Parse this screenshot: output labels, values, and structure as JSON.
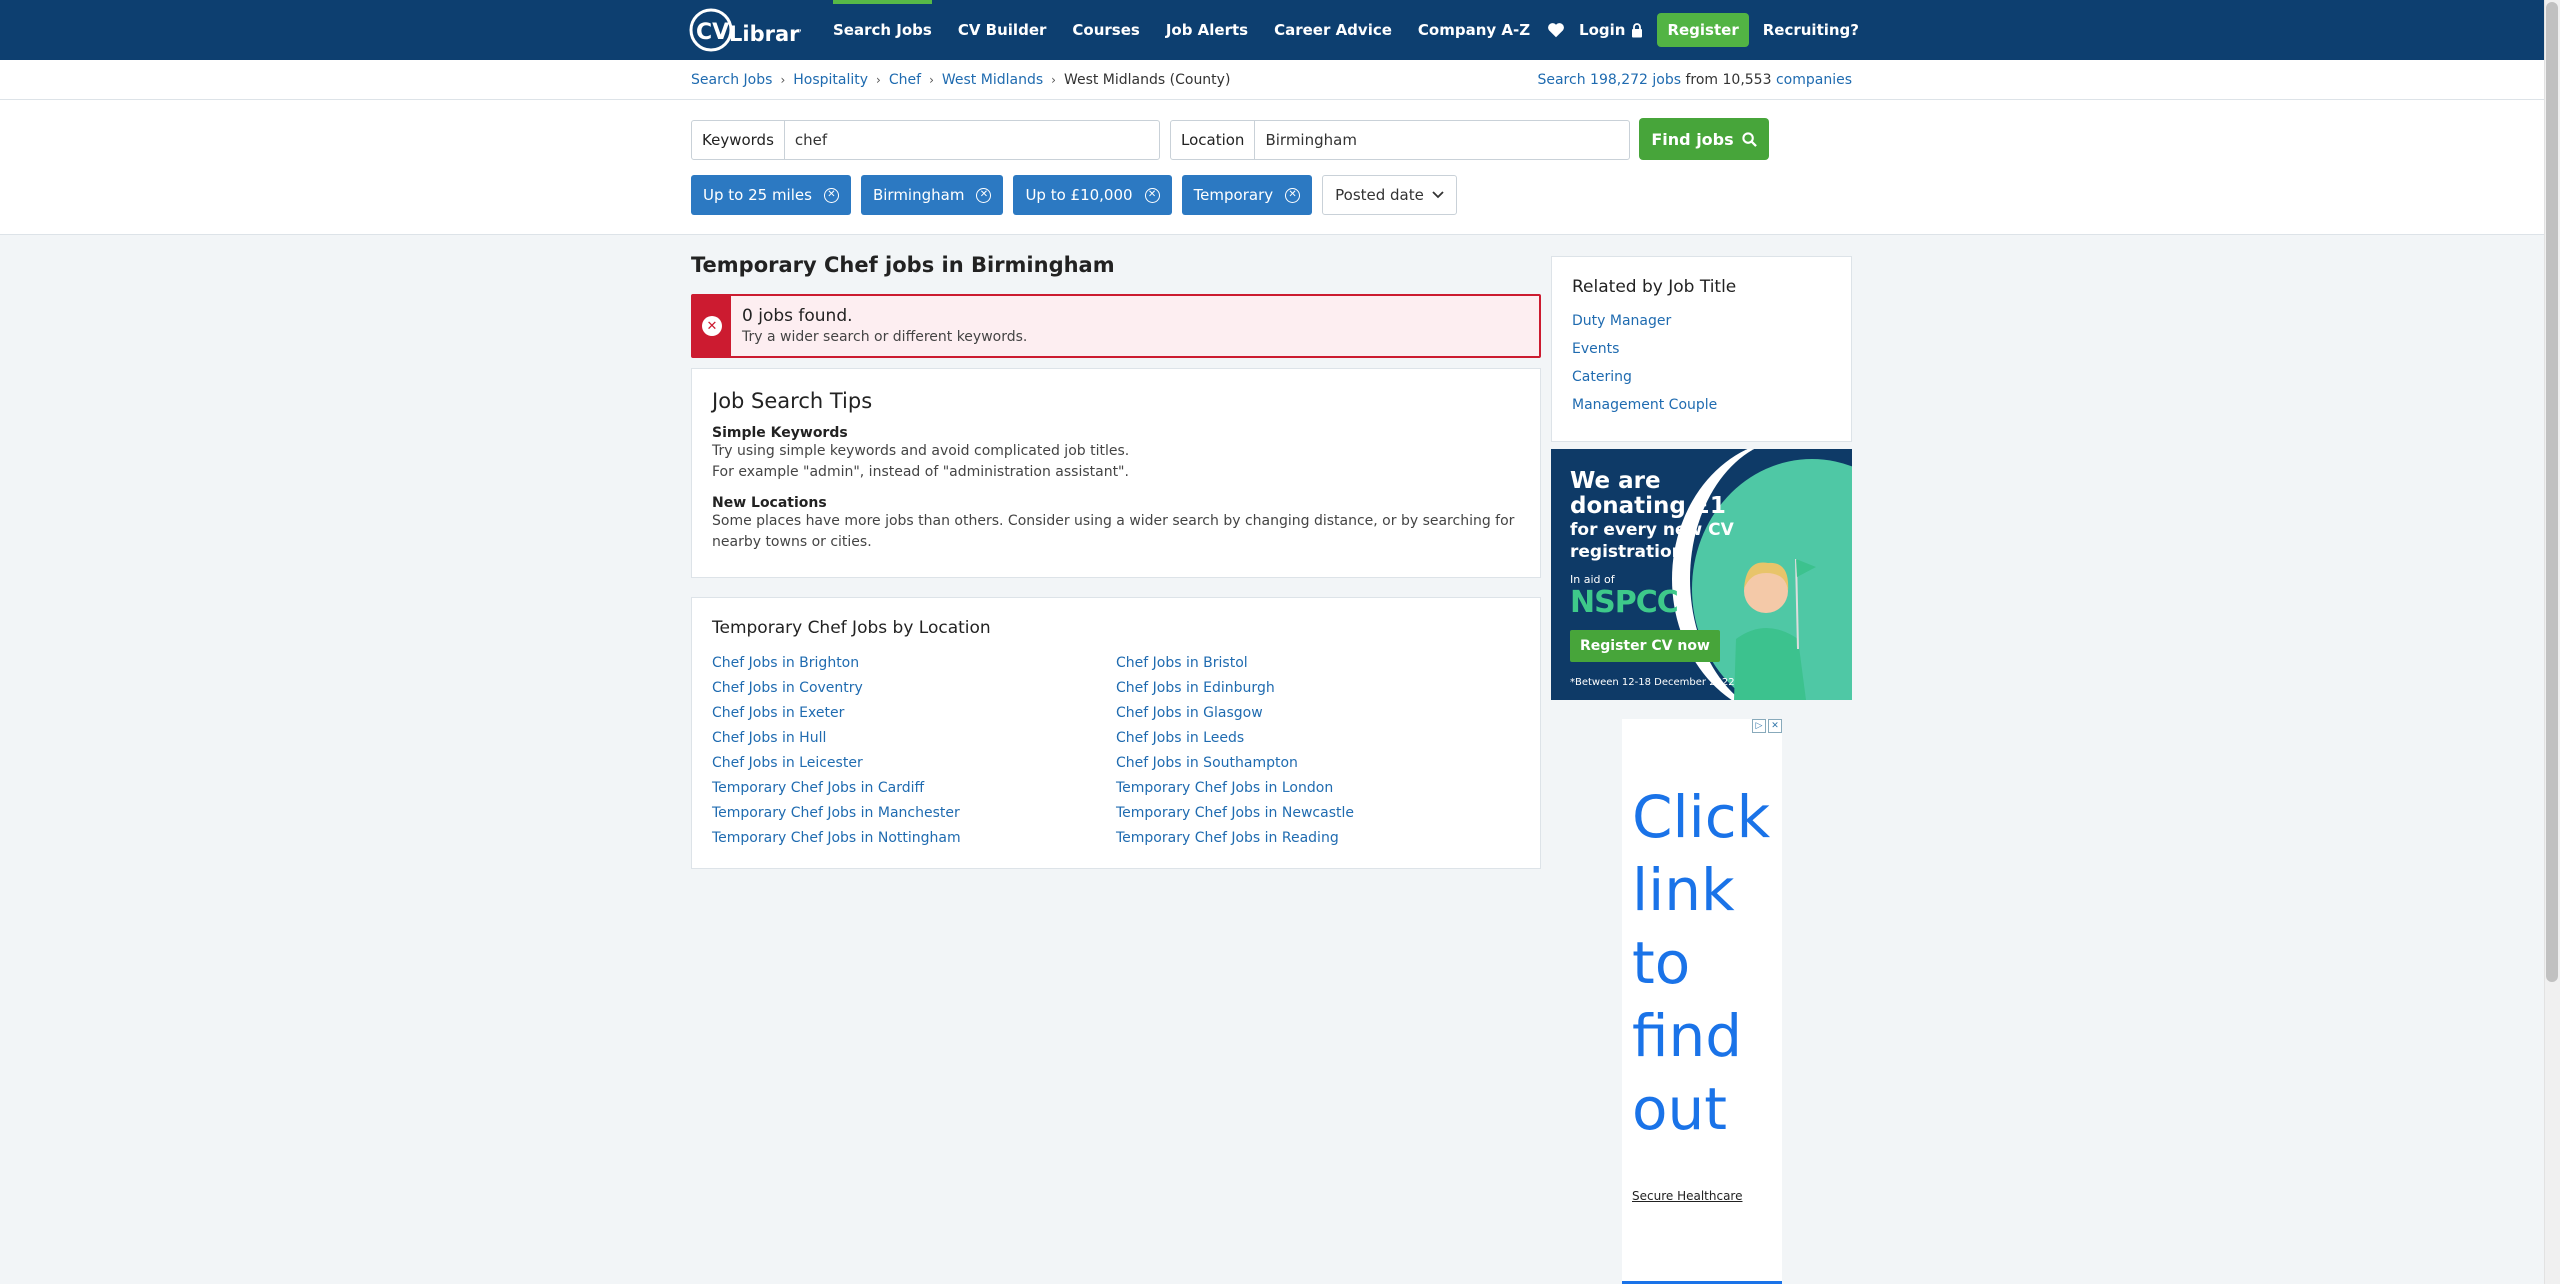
{
  "header": {
    "logo_text": "CV Library",
    "nav": [
      {
        "label": "Search Jobs"
      },
      {
        "label": "CV Builder"
      },
      {
        "label": "Courses"
      },
      {
        "label": "Job Alerts"
      },
      {
        "label": "Career Advice"
      },
      {
        "label": "Company A-Z"
      }
    ],
    "login_label": "Login",
    "register_label": "Register",
    "recruiting_label": "Recruiting?"
  },
  "breadcrumb": {
    "items": [
      "Search Jobs",
      "Hospitality",
      "Chef",
      "West Midlands"
    ],
    "current": "West Midlands (County)",
    "search_prefix": "Search",
    "jobs_count": "198,272 jobs",
    "from_text": "from 10,553",
    "companies_label": "companies"
  },
  "search": {
    "keywords_label": "Keywords",
    "keywords_value": "chef",
    "location_label": "Location",
    "location_value": "Birmingham",
    "find_label": "Find jobs",
    "filters": [
      "Up to 25 miles",
      "Birmingham",
      "Up to £10,000",
      "Temporary"
    ],
    "sort_label": "Posted date"
  },
  "results": {
    "title": "Temporary Chef jobs in Birmingham",
    "alert_title": "0 jobs found.",
    "alert_sub": "Try a wider search or different keywords."
  },
  "tips": {
    "title": "Job Search Tips",
    "h1": "Simple Keywords",
    "p1a": "Try using simple keywords and avoid complicated job titles.",
    "p1b": "For example \"admin\", instead of \"administration assistant\".",
    "h2": "New Locations",
    "p2": "Some places have more jobs than others. Consider using a wider search by changing distance, or by searching for nearby towns or cities."
  },
  "locations": {
    "title": "Temporary Chef Jobs by Location",
    "links": [
      "Chef Jobs in Brighton",
      "Chef Jobs in Bristol",
      "Chef Jobs in Coventry",
      "Chef Jobs in Edinburgh",
      "Chef Jobs in Exeter",
      "Chef Jobs in Glasgow",
      "Chef Jobs in Hull",
      "Chef Jobs in Leeds",
      "Chef Jobs in Leicester",
      "Chef Jobs in Southampton",
      "Temporary Chef Jobs in Cardiff",
      "Temporary Chef Jobs in London",
      "Temporary Chef Jobs in Manchester",
      "Temporary Chef Jobs in Newcastle",
      "Temporary Chef Jobs in Nottingham",
      "Temporary Chef Jobs in Reading"
    ]
  },
  "related": {
    "title": "Related by Job Title",
    "links": [
      "Duty Manager",
      "Events",
      "Catering",
      "Management Couple"
    ]
  },
  "ad_nspcc": {
    "line1": "We are",
    "line2": "donating £1",
    "line3": "for every new CV",
    "line4": "registration*",
    "in_aid": "In aid of",
    "charity": "NSPCC",
    "cta": "Register CV now",
    "fine": "*Between 12-18 December 2022"
  },
  "ad_healthcare": {
    "lines": [
      "Click",
      "link",
      "to",
      "find",
      "out"
    ],
    "brand": "Secure Healthcare"
  },
  "colors": {
    "header_bg": "#0d3f70",
    "accent_green": "#52b444",
    "chip_blue": "#2c79c2",
    "alert_red": "#cc1b30",
    "link_blue": "#1f6bb0"
  }
}
